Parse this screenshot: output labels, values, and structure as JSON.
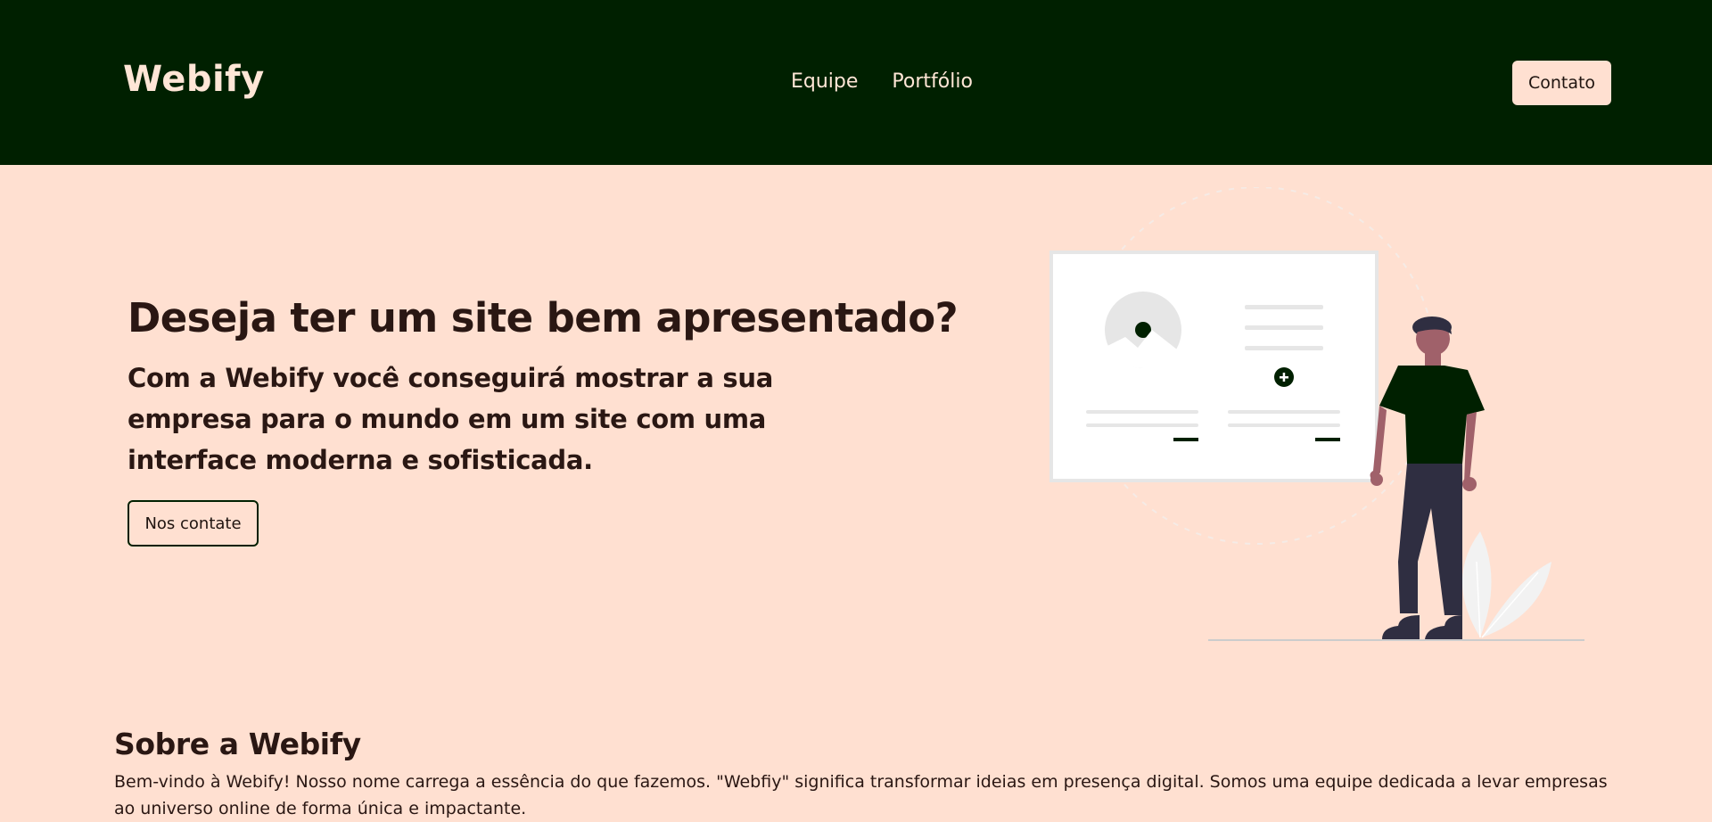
{
  "header": {
    "logo": "Webify",
    "nav": [
      "Equipe",
      "Portfólio"
    ],
    "contact_button": "Contato"
  },
  "hero": {
    "title": "Deseja ter um site bem apresentado?",
    "subtitle": "Com a Webify você conseguirá mostrar a sua empresa para o mundo em um site com uma interface moderna e sofisticada.",
    "cta_label": "Nos contate"
  },
  "about": {
    "title": "Sobre a Webify",
    "text": "Bem-vindo à Webify! Nosso nome carrega a essência do que fazemos. \"Webfiy\" significa transformar ideias em presença digital. Somos uma equipe dedicada a levar empresas ao universo online de forma única e impactante."
  },
  "icons": [
    "plus-icon",
    "image-placeholder-icon"
  ],
  "colors": {
    "header_bg": "#002000",
    "page_bg": "#ffe0d1",
    "text_dark": "#2a1713",
    "accent_light": "#ffe6d6"
  }
}
